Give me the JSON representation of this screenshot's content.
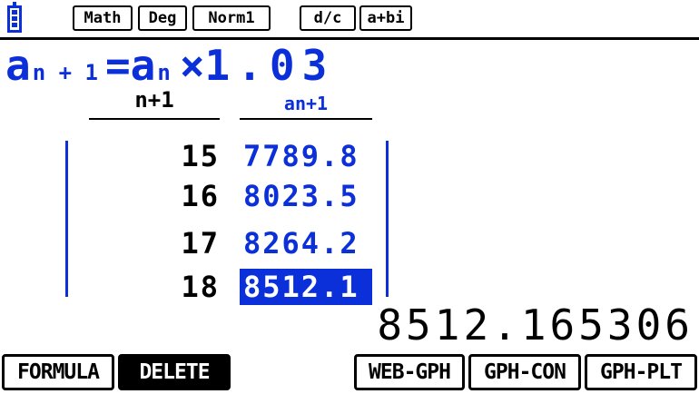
{
  "status_bar": {
    "battery_icon": "battery-icon",
    "badges": [
      "Math",
      "Deg",
      "Norm1",
      "d/c",
      "a+bi"
    ]
  },
  "formula": {
    "lhs_var": "a",
    "lhs_sub": "n + 1",
    "equals": "=",
    "rhs_var": "a",
    "rhs_sub": "n",
    "operator": "×",
    "factor": "1.03"
  },
  "table": {
    "headers": [
      "n+1",
      "an+1"
    ],
    "rows": [
      {
        "n": "15",
        "a": "7789.8"
      },
      {
        "n": "16",
        "a": "8023.5"
      },
      {
        "n": "17",
        "a": "8264.2"
      },
      {
        "n": "18",
        "a": "8512.1"
      }
    ],
    "selected_row": 3
  },
  "current_value": "8512.165306",
  "function_keys": [
    "FORMULA",
    "DELETE",
    "WEB-GPH",
    "GPH-CON",
    "GPH-PLT"
  ],
  "colors": {
    "accent_blue": "#0b2fd8",
    "background": "#ffffff",
    "text": "#000000"
  }
}
